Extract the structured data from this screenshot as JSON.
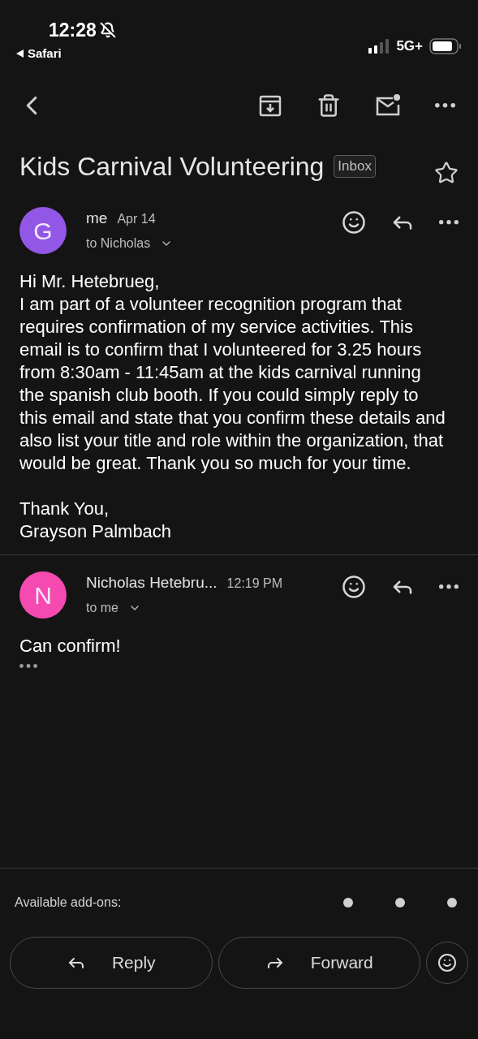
{
  "status_bar": {
    "time": "12:28",
    "back_app": "Safari",
    "network": "5G+"
  },
  "subject": {
    "title": "Kids Carnival Volunteering",
    "label": "Inbox",
    "starred": false
  },
  "messages": [
    {
      "avatar": "G",
      "color": "#9257e6",
      "sender": "me",
      "time": "Apr 14",
      "recipients": "to Nicholas",
      "body": [
        "Hi Mr. Hetebrueg,\nI am part of a volunteer recognition program that requires confirmation of my service activities. This email is to confirm that I volunteered for 3.25 hours from 8:30am - 11:45am at the kids carnival running the spanish club booth. If you could simply reply to this email and state that you confirm these details and also list your title and role within the organization, that would be great.  Thank you so much for your time.",
        "Thank You,\nGrayson Palmbach"
      ],
      "quoted_hidden": false
    },
    {
      "avatar": "N",
      "color": "#f54ab0",
      "sender": "Nicholas Hetebru...",
      "time": "12:19 PM",
      "recipients": "to me",
      "body": [
        "Can confirm!"
      ],
      "quoted_hidden": true
    }
  ],
  "addons": {
    "label": "Available add-ons:"
  },
  "actions": [
    {
      "kind": "reply",
      "label": "Reply"
    },
    {
      "kind": "forward",
      "label": "Forward"
    }
  ]
}
